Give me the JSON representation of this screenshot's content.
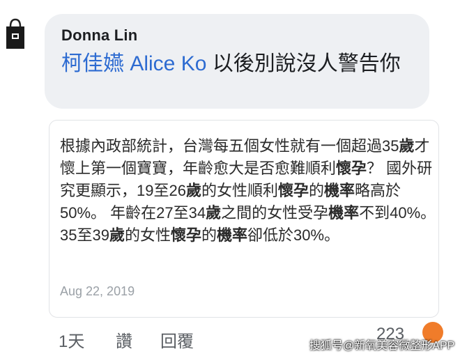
{
  "comment": {
    "author": "Donna Lin",
    "mention": "柯佳嬿 Alice Ko",
    "text": " 以後別說沒人警告你"
  },
  "shared_post": {
    "segments": [
      {
        "t": "根據內政部統計，台灣每五個女性就有一個超過35",
        "b": false
      },
      {
        "t": "歲",
        "b": true
      },
      {
        "t": "才懷上第一個寶寶，年齡愈大是否愈難順利",
        "b": false
      },
      {
        "t": "懷孕",
        "b": true
      },
      {
        "t": "？ 國外研究更顯示，19至26",
        "b": false
      },
      {
        "t": "歲",
        "b": true
      },
      {
        "t": "的女性順利",
        "b": false
      },
      {
        "t": "懷孕",
        "b": true
      },
      {
        "t": "的",
        "b": false
      },
      {
        "t": "機率",
        "b": true
      },
      {
        "t": "略高於50%。 年齡在27至34",
        "b": false
      },
      {
        "t": "歲",
        "b": true
      },
      {
        "t": "之間的女性受孕",
        "b": false
      },
      {
        "t": "機率",
        "b": true
      },
      {
        "t": "不到40%。 35至39",
        "b": false
      },
      {
        "t": "歲",
        "b": true
      },
      {
        "t": "的女性",
        "b": false
      },
      {
        "t": "懷孕",
        "b": true
      },
      {
        "t": "的",
        "b": false
      },
      {
        "t": "機率",
        "b": true
      },
      {
        "t": "卻低於30%。",
        "b": false
      }
    ],
    "date": "Aug 22, 2019"
  },
  "actions": {
    "time": "1天",
    "like": "讚",
    "reply": "回覆",
    "reaction_count": "223",
    "reaction_icon": "haha-reaction-icon"
  },
  "watermark": "搜狐号@新氧美容微整形APP",
  "colors": {
    "mention": "#2d6bd1",
    "bubble": "#eef0f3",
    "reaction": "#f07c2a"
  }
}
